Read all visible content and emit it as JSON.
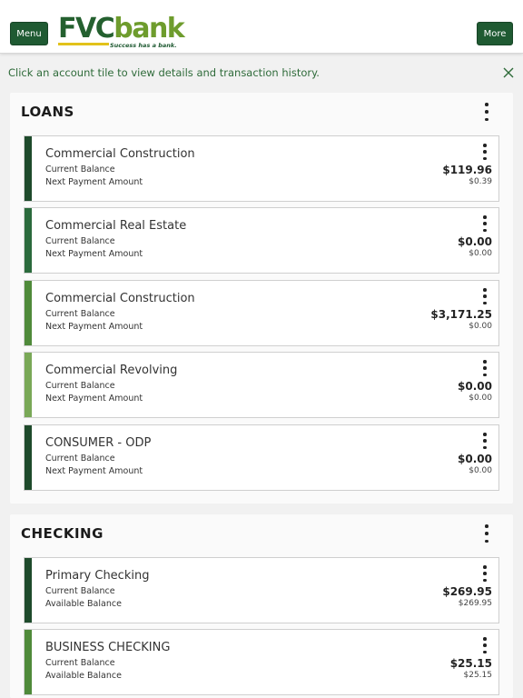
{
  "header": {
    "menu_label": "Menu",
    "more_label": "More",
    "logo": {
      "part1": "FVC",
      "part2": "bank",
      "tagline": "Success has a bank."
    }
  },
  "notice": {
    "text": "Click an account tile to view details and transaction history."
  },
  "colors": {
    "brand_dark": "#1f5a32",
    "brand_light": "#6e9c2d",
    "accent_yellow": "#e2c21a",
    "notice_text": "#2f6b3a"
  },
  "icons": {
    "close": "close-icon",
    "more": "kebab-icon"
  },
  "sections": [
    {
      "title": "LOANS",
      "accounts": [
        {
          "name": "Commercial Construction",
          "label1": "Current Balance",
          "label2": "Next Payment Amount",
          "value1": "$119.96",
          "value2": "$0.39",
          "bar_color": "#1e4a2b"
        },
        {
          "name": "Commercial Real Estate",
          "label1": "Current Balance",
          "label2": "Next Payment Amount",
          "value1": "$0.00",
          "value2": "$0.00",
          "bar_color": "#2a6a3c"
        },
        {
          "name": "Commercial Construction",
          "label1": "Current Balance",
          "label2": "Next Payment Amount",
          "value1": "$3,171.25",
          "value2": "$0.00",
          "bar_color": "#4f8a3a"
        },
        {
          "name": "Commercial Revolving",
          "label1": "Current Balance",
          "label2": "Next Payment Amount",
          "value1": "$0.00",
          "value2": "$0.00",
          "bar_color": "#79a857"
        },
        {
          "name": "CONSUMER - ODP",
          "label1": "Current Balance",
          "label2": "Next Payment Amount",
          "value1": "$0.00",
          "value2": "$0.00",
          "bar_color": "#1e4a2b"
        }
      ]
    },
    {
      "title": "CHECKING",
      "accounts": [
        {
          "name": "Primary Checking",
          "label1": "Current Balance",
          "label2": "Available Balance",
          "value1": "$269.95",
          "value2": "$269.95",
          "bar_color": "#1e4a2b"
        },
        {
          "name": "BUSINESS CHECKING",
          "label1": "Current Balance",
          "label2": "Available Balance",
          "value1": "$25.15",
          "value2": "$25.15",
          "bar_color": "#4f8a3a"
        }
      ]
    }
  ]
}
